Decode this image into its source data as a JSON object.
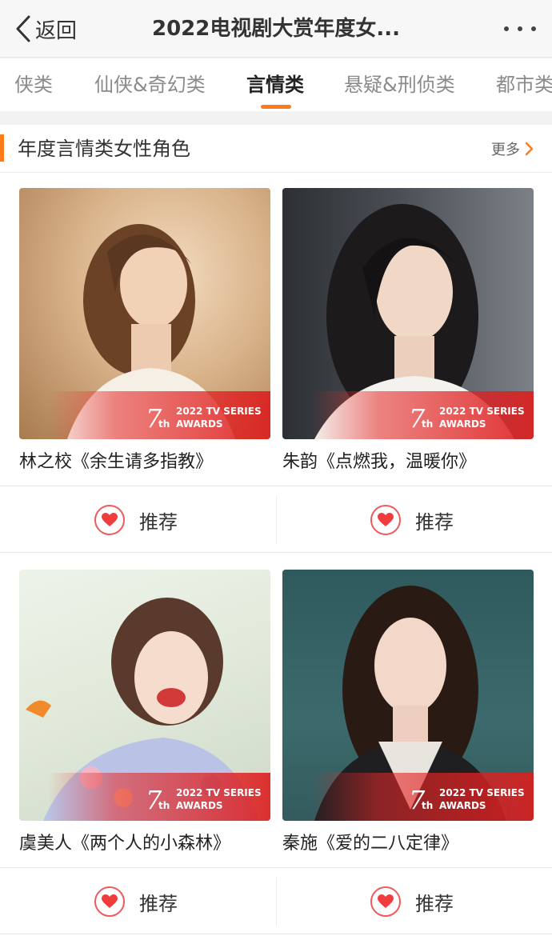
{
  "nav": {
    "back_label": "返回",
    "title": "2022电视剧大赏年度女..."
  },
  "tabs": [
    {
      "label": "侠类",
      "active": false
    },
    {
      "label": "仙侠&奇幻类",
      "active": false
    },
    {
      "label": "言情类",
      "active": true
    },
    {
      "label": "悬疑&刑侦类",
      "active": false
    },
    {
      "label": "都市类",
      "active": false
    }
  ],
  "section": {
    "title": "年度言情类女性角色",
    "more_label": "更多"
  },
  "badge": {
    "number": "7",
    "suffix": "th",
    "line1": "2022 TV SERIES",
    "line2": "AWARDS"
  },
  "cards": [
    {
      "caption": "林之校《余生请多指教》"
    },
    {
      "caption": "朱韵《点燃我，温暖你》"
    },
    {
      "caption": "虞美人《两个人的小森林》"
    },
    {
      "caption": "秦施《爱的二八定律》"
    }
  ],
  "recommend_label": "推荐",
  "colors": {
    "accent": "#ff7a1a",
    "heart": "#f03c3c",
    "badge_red": "#e02a2a"
  }
}
